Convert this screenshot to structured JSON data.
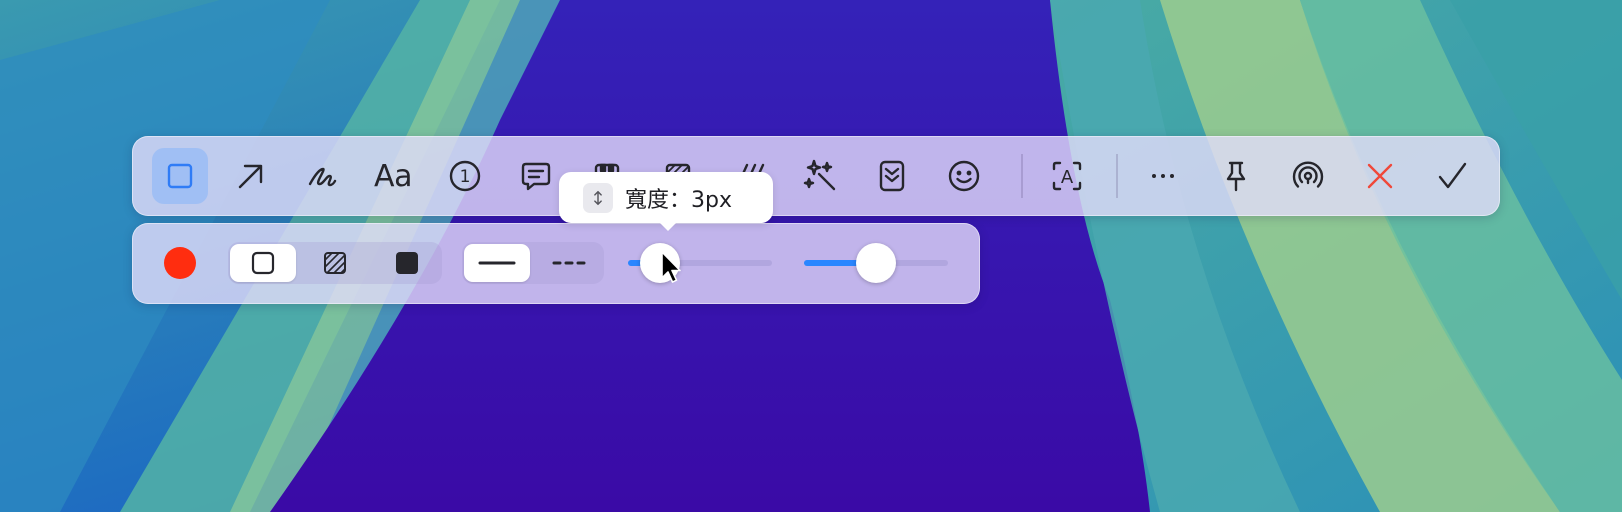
{
  "colors": {
    "accent": "#2F7CF6",
    "slider_fill": "#2A86FF",
    "selected_color": "#FF2D0F",
    "cancel": "#F0483A",
    "icon": "#26262C"
  },
  "toolbar": {
    "tools": [
      {
        "id": "rectangle",
        "icon": "square-icon",
        "active": true
      },
      {
        "id": "arrow",
        "icon": "arrow-up-right-icon"
      },
      {
        "id": "pen",
        "icon": "scribble-icon"
      },
      {
        "id": "text",
        "icon": "text-icon",
        "label": "Aa"
      },
      {
        "id": "counter",
        "icon": "number-circle-icon",
        "label": "1"
      },
      {
        "id": "comment",
        "icon": "speech-bubble-icon"
      },
      {
        "id": "mosaic",
        "icon": "mosaic-icon"
      },
      {
        "id": "blur",
        "icon": "hatched-square-icon"
      },
      {
        "id": "highlighter",
        "icon": "diagonal-strokes-icon"
      },
      {
        "id": "magic",
        "icon": "magic-wand-sparkles-icon"
      },
      {
        "id": "long-screenshot",
        "icon": "chevrons-down-icon"
      },
      {
        "id": "sticker",
        "icon": "smiley-icon"
      },
      {
        "id": "ocr",
        "icon": "text-recognition-icon",
        "label": "A"
      },
      {
        "id": "more",
        "icon": "more-dots-icon"
      },
      {
        "id": "pin",
        "icon": "pin-icon"
      },
      {
        "id": "share",
        "icon": "airdrop-icon"
      },
      {
        "id": "cancel",
        "icon": "close-icon"
      },
      {
        "id": "confirm",
        "icon": "checkmark-icon"
      }
    ]
  },
  "options": {
    "fill_modes": [
      "outline-square-icon",
      "hatched-square-icon",
      "filled-square-icon"
    ],
    "fill_selected": 0,
    "line_styles": [
      "solid-line-icon",
      "dashed-line-icon"
    ],
    "line_selected": 0,
    "stroke_width_level": 0.22,
    "opacity_level": 0.5
  },
  "tooltip": {
    "icon": "vertical-resize-icon",
    "label": "寬度：3px"
  }
}
